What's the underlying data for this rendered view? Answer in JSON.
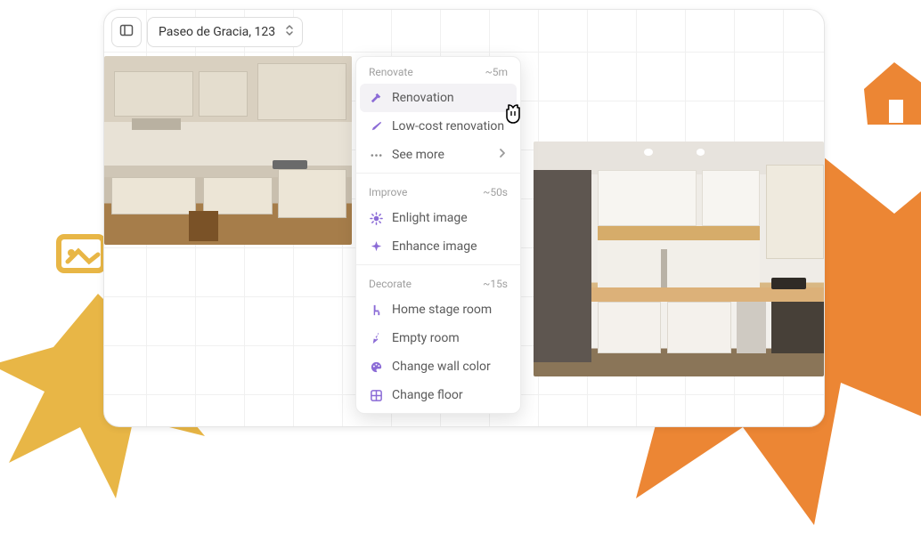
{
  "address": "Paseo de Gracia, 123",
  "menu": {
    "sections": [
      {
        "title": "Renovate",
        "time": "~5m",
        "items": [
          {
            "label": "Renovation",
            "icon": "hammer-icon",
            "highlight": true
          },
          {
            "label": "Low-cost renovation",
            "icon": "brush-icon"
          },
          {
            "label": "See more",
            "icon": "dots-icon",
            "more": true
          }
        ]
      },
      {
        "title": "Improve",
        "time": "~50s",
        "items": [
          {
            "label": "Enlight image",
            "icon": "sun-icon"
          },
          {
            "label": "Enhance image",
            "icon": "sparkle-icon"
          }
        ]
      },
      {
        "title": "Decorate",
        "time": "~15s",
        "items": [
          {
            "label": "Home stage room",
            "icon": "chair-icon"
          },
          {
            "label": "Empty room",
            "icon": "broom-icon"
          },
          {
            "label": "Change wall color",
            "icon": "palette-icon"
          },
          {
            "label": "Change floor",
            "icon": "grid-icon"
          }
        ]
      }
    ]
  }
}
